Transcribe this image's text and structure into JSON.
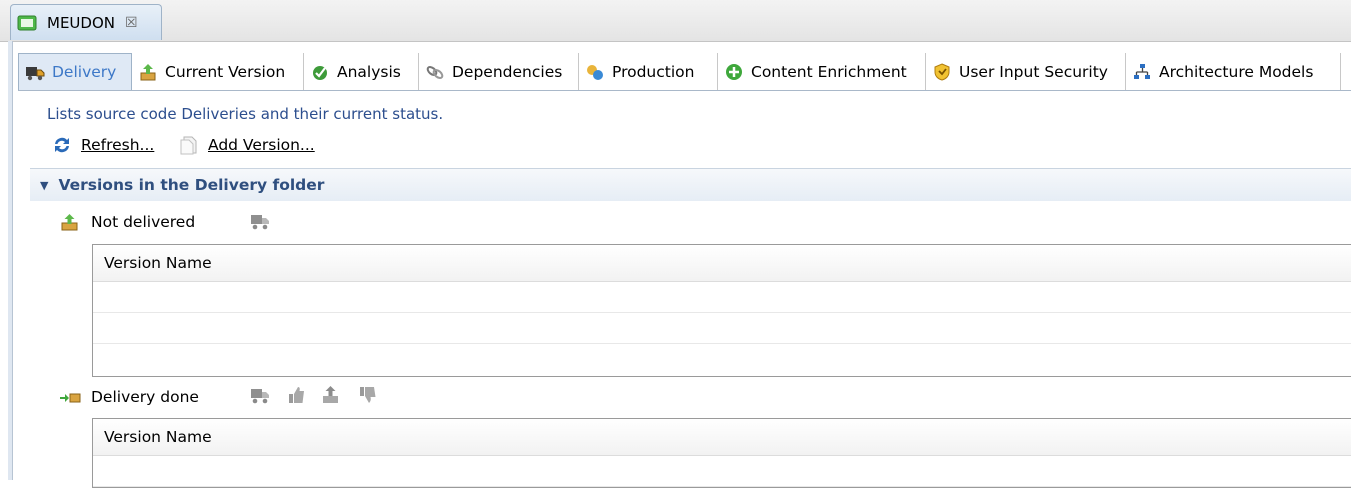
{
  "editor": {
    "tab_title": "MEUDON",
    "close_glyph": "☒"
  },
  "page_tabs": [
    {
      "label": "Delivery",
      "icon": "delivery-truck-icon",
      "active": true
    },
    {
      "label": "Current Version",
      "icon": "current-version-icon",
      "active": false
    },
    {
      "label": "Analysis",
      "icon": "analysis-icon",
      "active": false
    },
    {
      "label": "Dependencies",
      "icon": "dependencies-icon",
      "active": false
    },
    {
      "label": "Production",
      "icon": "production-icon",
      "active": false
    },
    {
      "label": "Content Enrichment",
      "icon": "content-enrichment-icon",
      "active": false
    },
    {
      "label": "User Input Security",
      "icon": "user-input-security-icon",
      "active": false
    },
    {
      "label": "Architecture Models",
      "icon": "architecture-models-icon",
      "active": false
    }
  ],
  "main": {
    "description": "Lists source code Deliveries and their current status.",
    "refresh_label": "Refresh...",
    "add_version_label": "Add Version...",
    "section_title": "Versions in the Delivery folder",
    "not_delivered": {
      "label": "Not delivered",
      "table_header": "Version Name"
    },
    "delivery_done": {
      "label": "Delivery done",
      "table_header": "Version Name"
    }
  },
  "colors": {
    "accent_text": "#3d78c7",
    "section_title": "#2f4f7f",
    "description": "#2c4e8e"
  }
}
